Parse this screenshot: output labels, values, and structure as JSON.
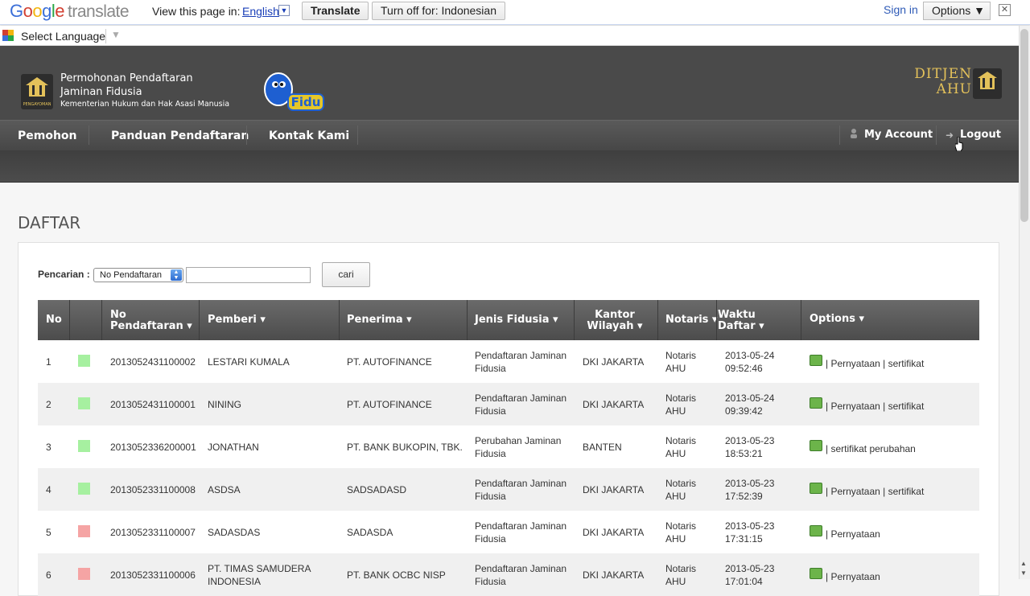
{
  "translate_bar": {
    "logo_google": "Google",
    "logo_translate": "translate",
    "view_label": "View this page in:",
    "language": "English",
    "translate_btn": "Translate",
    "turn_off_btn": "Turn off for: Indonesian",
    "sign_in": "Sign in",
    "options": "Options ▼",
    "close": "✕"
  },
  "language_bar": {
    "label": "Select Language"
  },
  "header": {
    "title_line1": "Permohonan Pendaftaran",
    "title_line2": "Jaminan Fidusia",
    "subtitle": "Kementerian Hukum dan Hak Asasi Manusia",
    "emblem_caption": "PENGAYOMAN",
    "brand_line1": "DITJEN",
    "brand_line2": "AHU",
    "fidu_logo": "Fidu"
  },
  "nav": {
    "items": [
      "Pemohon",
      "Panduan Pendaftaran",
      "Kontak Kami"
    ],
    "my_account": "My Account",
    "logout": "Logout"
  },
  "page": {
    "title": "DAFTAR"
  },
  "search": {
    "label": "Pencarian :",
    "field_selected": "No Pendaftaran",
    "query": "",
    "button": "cari"
  },
  "table": {
    "headers": {
      "no": "No",
      "no_pendaftaran_1": "No",
      "no_pendaftaran_2": "Pendaftaran",
      "pemberi": "Pemberi",
      "penerima": "Penerima",
      "jenis": "Jenis Fidusia",
      "kantor_1": "Kantor",
      "kantor_2": "Wilayah",
      "notaris": "Notaris",
      "waktu_1": "Waktu",
      "waktu_2": "Daftar",
      "options": "Options"
    },
    "rows": [
      {
        "no": "1",
        "status": "green",
        "reg": "201305243110000​2",
        "pemberi": "LESTARI KUMALA",
        "pemberi2": "",
        "penerima": "PT. AUTOFINANCE",
        "jenis1": "Pendaftaran Jaminan",
        "jenis2": "Fidusia",
        "kantor": "DKI JAKARTA",
        "notaris1": "Notaris",
        "notaris2": "AHU",
        "date": "2013-05-24",
        "time": "09:52:46",
        "options": "| Pernyataan | sertifikat"
      },
      {
        "no": "2",
        "status": "green",
        "reg": "201305243110000​1",
        "pemberi": "NINING",
        "pemberi2": "",
        "penerima": "PT. AUTOFINANCE",
        "jenis1": "Pendaftaran Jaminan",
        "jenis2": "Fidusia",
        "kantor": "DKI JAKARTA",
        "notaris1": "Notaris",
        "notaris2": "AHU",
        "date": "2013-05-24",
        "time": "09:39:42",
        "options": "| Pernyataan | sertifikat"
      },
      {
        "no": "3",
        "status": "green",
        "reg": "201305233620000​1",
        "pemberi": "JONATHAN",
        "pemberi2": "",
        "penerima": "PT. BANK BUKOPIN, TBK.",
        "jenis1": "Perubahan Jaminan",
        "jenis2": "Fidusia",
        "kantor": "BANTEN",
        "notaris1": "Notaris",
        "notaris2": "AHU",
        "date": "2013-05-23",
        "time": "18:53:21",
        "options": "| sertifikat perubahan"
      },
      {
        "no": "4",
        "status": "green",
        "reg": "201305233110000​8",
        "pemberi": "ASDSA",
        "pemberi2": "",
        "penerima": "SADSADASD",
        "jenis1": "Pendaftaran Jaminan",
        "jenis2": "Fidusia",
        "kantor": "DKI JAKARTA",
        "notaris1": "Notaris",
        "notaris2": "AHU",
        "date": "2013-05-23",
        "time": "17:52:39",
        "options": "| Pernyataan | sertifikat"
      },
      {
        "no": "5",
        "status": "red",
        "reg": "201305233110000​7",
        "pemberi": "SADASDAS",
        "pemberi2": "",
        "penerima": "SADASDA",
        "jenis1": "Pendaftaran Jaminan",
        "jenis2": "Fidusia",
        "kantor": "DKI JAKARTA",
        "notaris1": "Notaris",
        "notaris2": "AHU",
        "date": "2013-05-23",
        "time": "17:31:15",
        "options": "| Pernyataan"
      },
      {
        "no": "6",
        "status": "red",
        "reg": "201305233110000​6",
        "pemberi": "PT. TIMAS SAMUDERA",
        "pemberi2": "INDONESIA",
        "penerima": "PT. BANK OCBC NISP",
        "jenis1": "Pendaftaran Jaminan",
        "jenis2": "Fidusia",
        "kantor": "DKI JAKARTA",
        "notaris1": "Notaris",
        "notaris2": "AHU",
        "date": "2013-05-23",
        "time": "17:01:04",
        "options": "| Pernyataan"
      }
    ]
  },
  "colors": {
    "status_green": "#a6f0a0",
    "status_red": "#f5a4a4",
    "header_bg": "#4a4a4a",
    "brand_gold": "#e3c15a"
  }
}
